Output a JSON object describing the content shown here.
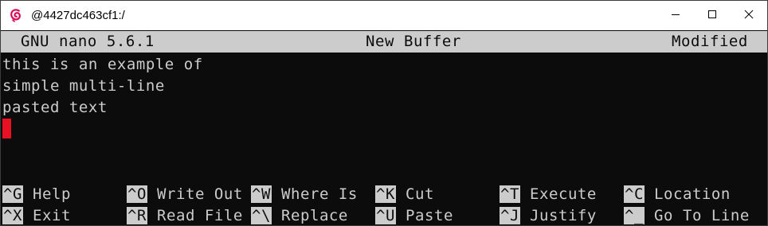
{
  "window": {
    "title": "@4427dc463cf1:/",
    "app_icon": "debian-swirl-icon",
    "controls": [
      "minimize-icon",
      "maximize-icon",
      "close-icon"
    ]
  },
  "nano": {
    "version_label": "GNU nano 5.6.1",
    "buffer_name": "New Buffer",
    "state": "Modified"
  },
  "buffer": {
    "lines": [
      "this is an example of",
      "simple multi-line",
      "pasted text"
    ]
  },
  "shortcuts": [
    [
      {
        "key": "^G",
        "label": "Help"
      },
      {
        "key": "^O",
        "label": "Write Out"
      },
      {
        "key": "^W",
        "label": "Where Is"
      },
      {
        "key": "^K",
        "label": "Cut"
      },
      {
        "key": "^T",
        "label": "Execute"
      },
      {
        "key": "^C",
        "label": "Location"
      }
    ],
    [
      {
        "key": "^X",
        "label": "Exit"
      },
      {
        "key": "^R",
        "label": "Read File"
      },
      {
        "key": "^\\",
        "label": "Replace"
      },
      {
        "key": "^U",
        "label": "Paste"
      },
      {
        "key": "^J",
        "label": "Justify"
      },
      {
        "key": "^_",
        "label": "Go To Line"
      }
    ]
  ],
  "colors": {
    "terminal_bg": "#0c0c0c",
    "terminal_fg": "#cccccc",
    "cursor": "#e81123",
    "titlebar_bg": "#ffffff",
    "debian_red": "#d70a53"
  }
}
